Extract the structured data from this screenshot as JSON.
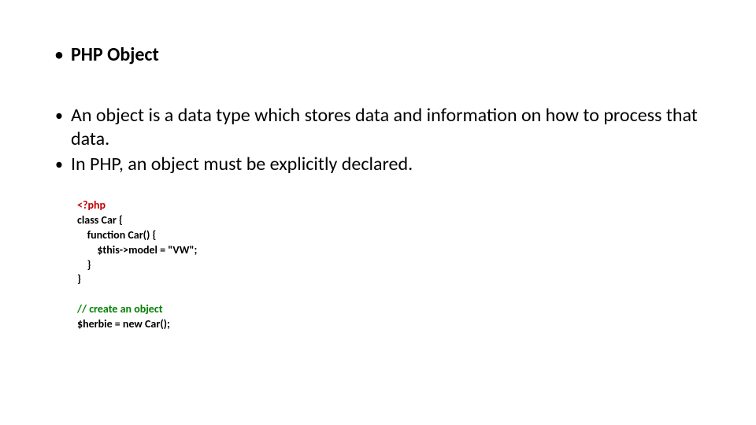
{
  "title": "PHP Object",
  "bullets": {
    "b1": "An object is a data type which stores data and information on how to process that data.",
    "b2": "In PHP, an object must be explicitly declared."
  },
  "code": {
    "l1": "<?php",
    "l2": "class Car {",
    "l3": "    function Car() {",
    "l4": "        $this->model = \"VW\";",
    "l5": "    }",
    "l6": "}",
    "l7": "// create an object",
    "l8": "$herbie = new Car();"
  }
}
